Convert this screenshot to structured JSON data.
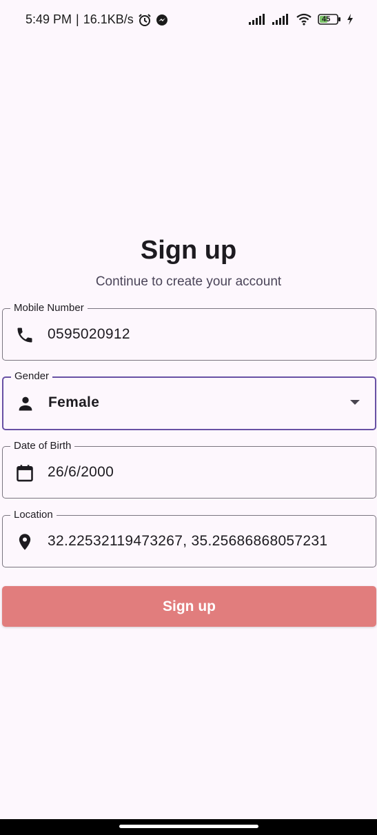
{
  "status_bar": {
    "time": "5:49 PM",
    "separator": "|",
    "network_speed": "16.1KB/s",
    "battery_level": "45",
    "icons": [
      "alarm-icon",
      "messenger-icon",
      "signal-icon",
      "signal-icon",
      "wifi-icon",
      "battery-icon",
      "charging-icon"
    ]
  },
  "header": {
    "title": "Sign up",
    "subtitle": "Continue to create your account"
  },
  "form": {
    "mobile": {
      "label": "Mobile Number",
      "value": "0595020912",
      "icon": "phone-icon"
    },
    "gender": {
      "label": "Gender",
      "value": "Female",
      "icon": "person-icon",
      "focused": true
    },
    "dob": {
      "label": "Date of Birth",
      "value": "26/6/2000",
      "icon": "calendar-icon"
    },
    "location": {
      "label": "Location",
      "value": "32.22532119473267, 35.25686868057231",
      "icon": "location-pin-icon"
    }
  },
  "actions": {
    "signup_label": "Sign up",
    "signup_color": "#e17d7d"
  },
  "colors": {
    "background": "#fdf7fd",
    "focus_border": "#6750a4",
    "outline": "#79747e"
  }
}
